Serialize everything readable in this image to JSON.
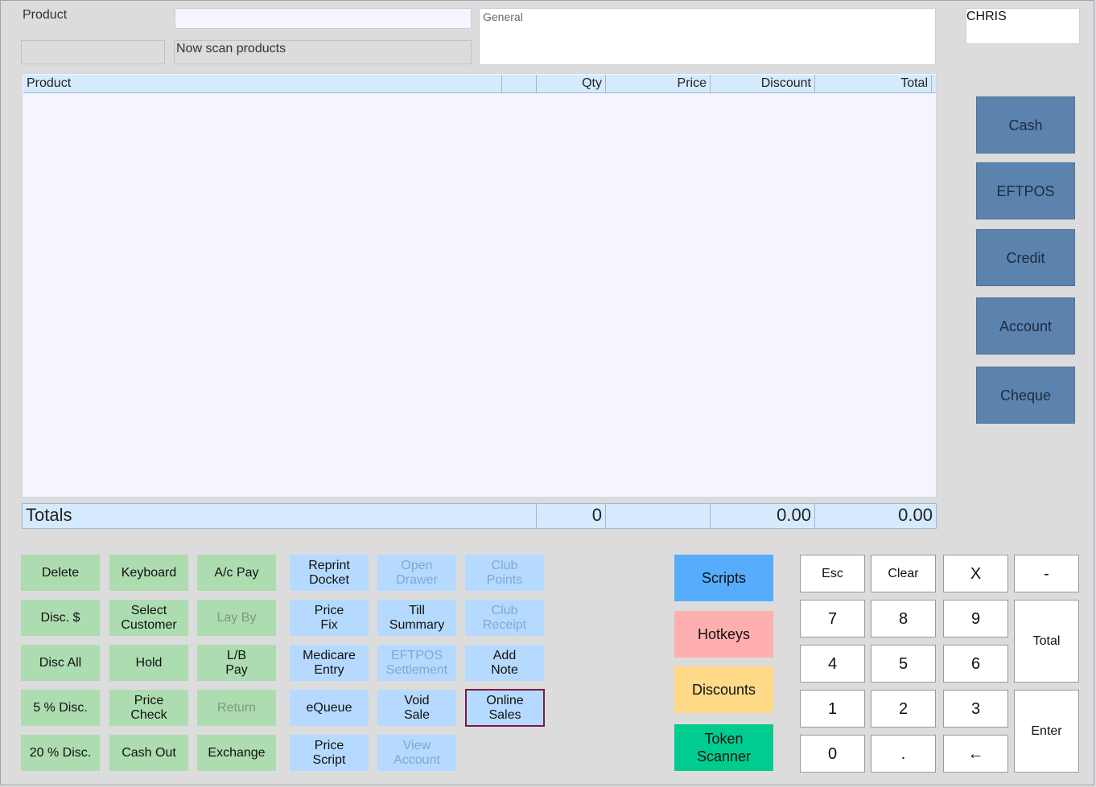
{
  "header": {
    "product_label": "Product",
    "status_message": "Now scan products",
    "general_text": "General",
    "operator": "CHRIS"
  },
  "grid": {
    "columns": [
      "Product",
      "",
      "Qty",
      "Price",
      "Discount",
      "Total"
    ],
    "rows": []
  },
  "totals": {
    "label": "Totals",
    "qty": "0",
    "discount": "0.00",
    "total": "0.00"
  },
  "payment_buttons": [
    "Cash",
    "EFTPOS",
    "Credit",
    "Account",
    "Cheque"
  ],
  "function_buttons": {
    "col1": [
      "Delete",
      "Disc. $",
      "Disc All",
      "5 % Disc.",
      "20 % Disc."
    ],
    "col2": [
      "Keyboard",
      "Select\nCustomer",
      "Hold",
      "Price\nCheck",
      "Cash Out"
    ],
    "col3": [
      "A/c Pay",
      "Lay By",
      "L/B\nPay",
      "Return",
      "Exchange"
    ],
    "col4": [
      "Reprint\nDocket",
      "Price\nFix",
      "Medicare\nEntry",
      "eQueue",
      "Price\nScript"
    ],
    "col5": [
      "Open\nDrawer",
      "Till\nSummary",
      "EFTPOS\nSettlement",
      "Void\nSale",
      "View\nAccount"
    ],
    "col6": [
      "Club\nPoints",
      "Club\nReceipt",
      "Add\nNote",
      "Online\nSales"
    ]
  },
  "side_buttons": {
    "scripts": "Scripts",
    "hotkeys": "Hotkeys",
    "discounts": "Discounts",
    "token_scanner": "Token\nScanner"
  },
  "keypad": {
    "esc": "Esc",
    "clear": "Clear",
    "multiply": "X",
    "minus": "-",
    "k7": "7",
    "k8": "8",
    "k9": "9",
    "total": "Total",
    "k4": "4",
    "k5": "5",
    "k6": "6",
    "k1": "1",
    "k2": "2",
    "k3": "3",
    "enter": "Enter",
    "k0": "0",
    "dot": ".",
    "backspace": "←"
  },
  "colors": {
    "function_green": "#addcb0",
    "function_blue": "#b6daff",
    "payment_blue": "#5b83ad",
    "scripts": "#57adfc",
    "hotkeys": "#ffafaf",
    "discounts": "#ffda89",
    "token_scanner": "#00cc8f"
  }
}
